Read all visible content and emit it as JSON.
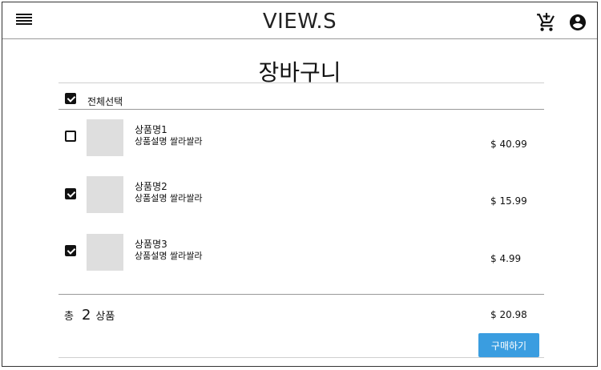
{
  "app": {
    "logo": "VIEW.S"
  },
  "icons": {
    "menu": "menu-icon",
    "cart": "add-to-cart-icon",
    "user": "account-circle-icon"
  },
  "colors": {
    "accent": "#3a9de0",
    "thumbnail": "#dedede"
  },
  "page": {
    "title": "장바구니"
  },
  "select_all": {
    "label": "전체선택",
    "checked": true
  },
  "items": [
    {
      "name": "상품명1",
      "desc": "상품설명 쌀라쌀라",
      "price": "$ 40.99",
      "checked": false
    },
    {
      "name": "상품명2",
      "desc": "상품설명 쌀라쌀라",
      "price": "$ 15.99",
      "checked": true
    },
    {
      "name": "상품명3",
      "desc": "상품설명 쌀라쌀라",
      "price": "$ 4.99",
      "checked": true
    }
  ],
  "summary": {
    "label": "총",
    "count": "2",
    "unit": "상품",
    "price": "$ 20.98"
  },
  "buy_button": {
    "label": "구매하기"
  }
}
